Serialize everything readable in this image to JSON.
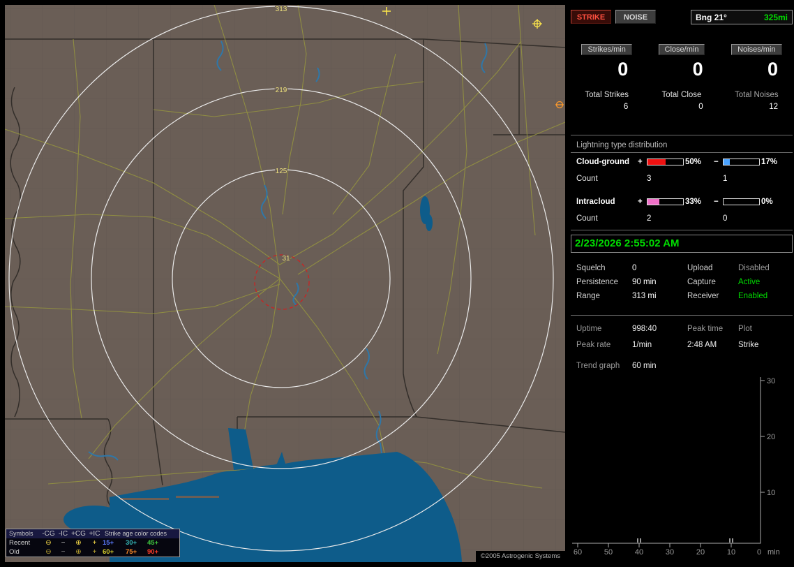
{
  "map": {
    "ring_labels": [
      "313",
      "219",
      "125",
      "31"
    ],
    "copyright": "©2005 Astrogenic Systems",
    "legend": {
      "symbols_header": "Symbols",
      "columns": [
        "-CG",
        "-IC",
        "+CG",
        "+IC"
      ],
      "age_header": "Strike age color codes",
      "rows": [
        {
          "label": "Recent",
          "symbols": [
            {
              "glyph": "⊖",
              "color": "#ffe14a"
            },
            {
              "glyph": "−",
              "color": "#c8c8c8"
            },
            {
              "glyph": "⊕",
              "color": "#ffe14a"
            },
            {
              "glyph": "+",
              "color": "#ffe14a"
            }
          ],
          "ages": [
            {
              "text": "15+",
              "color": "#5b7cff"
            },
            {
              "text": "30+",
              "color": "#35b8b8"
            },
            {
              "text": "45+",
              "color": "#3ec43e"
            }
          ]
        },
        {
          "label": "Old",
          "symbols": [
            {
              "glyph": "⊖",
              "color": "#bfa832"
            },
            {
              "glyph": "−",
              "color": "#8f8f8f"
            },
            {
              "glyph": "⊕",
              "color": "#bfa832"
            },
            {
              "glyph": "+",
              "color": "#bfa832"
            }
          ],
          "ages": [
            {
              "text": "60+",
              "color": "#d6ce2e"
            },
            {
              "text": "75+",
              "color": "#ff8c28"
            },
            {
              "text": "90+",
              "color": "#ff3c28"
            }
          ]
        }
      ]
    }
  },
  "panel": {
    "modes": [
      {
        "label": "STRIKE",
        "active": true
      },
      {
        "label": "NOISE",
        "active": false
      }
    ],
    "bearing": {
      "label": "Bng 21°",
      "range": "325mi"
    },
    "rates": [
      {
        "label": "Strikes/min",
        "value": "0"
      },
      {
        "label": "Close/min",
        "value": "0"
      },
      {
        "label": "Noises/min",
        "value": "0"
      }
    ],
    "totals": [
      {
        "label": "Total Strikes",
        "value": "6"
      },
      {
        "label": "Total Close",
        "value": "0"
      },
      {
        "label": "Total Noises",
        "value": "12"
      }
    ],
    "distribution": {
      "title": "Lightning type distribution",
      "rows": [
        {
          "name": "Cloud-ground",
          "plus_sign": "+",
          "plus_pct": "50%",
          "plus_fill": 50,
          "plus_color": "#ee1111",
          "minus_sign": "−",
          "minus_pct": "17%",
          "minus_fill": 17,
          "minus_color": "#4aa2ff",
          "count_label": "Count",
          "plus_count": "3",
          "minus_count": "1"
        },
        {
          "name": "Intracloud",
          "plus_sign": "+",
          "plus_pct": "33%",
          "plus_fill": 33,
          "plus_color": "#f070c8",
          "minus_sign": "−",
          "minus_pct": "0%",
          "minus_fill": 0,
          "minus_color": "#ffffff",
          "count_label": "Count",
          "plus_count": "2",
          "minus_count": "0"
        }
      ]
    },
    "clock": "2/23/2026 2:55:02 AM",
    "status": [
      {
        "label": "Squelch",
        "value": "0",
        "label2": "Upload",
        "value2": "Disabled",
        "value2_color": "#9a9a9a"
      },
      {
        "label": "Persistence",
        "value": "90 min",
        "label2": "Capture",
        "value2": "Active",
        "value2_color": "#00dd00"
      },
      {
        "label": "Range",
        "value": "313 mi",
        "label2": "Receiver",
        "value2": "Enabled",
        "value2_color": "#00dd00"
      }
    ],
    "info": {
      "uptime_label": "Uptime",
      "uptime": "998:40",
      "peak_time_label": "Peak time",
      "plot_label": "Plot",
      "peak_rate_label": "Peak rate",
      "peak_rate": "1/min",
      "peak_time": "2:48 AM",
      "plot_value": "Strike",
      "trend_label": "Trend graph",
      "trend_value": "60 min"
    },
    "trend_chart": {
      "type": "line",
      "y_ticks": [
        "30",
        "20",
        "10"
      ],
      "x_ticks": [
        "60",
        "50",
        "40",
        "30",
        "20",
        "10",
        "0"
      ],
      "x_unit": "min",
      "ylim": [
        0,
        30
      ],
      "series": []
    }
  },
  "colors": {
    "accent_green": "#00dd00",
    "strike_red": "#ff5040",
    "land": "#6a5e56",
    "water": "#0e5c8a"
  }
}
